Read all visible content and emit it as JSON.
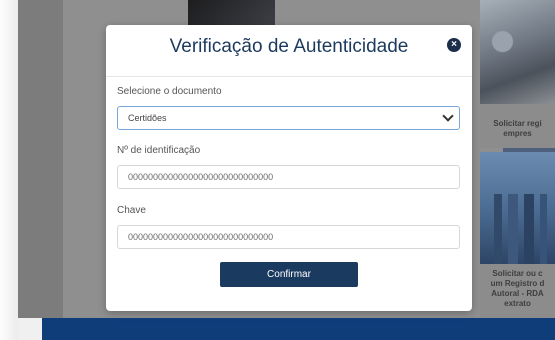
{
  "modal": {
    "title": "Verificação de Autenticidade",
    "close_symbol": "×",
    "document_label": "Selecione o documento",
    "document_selected": "Certidões",
    "id_label": "Nº de identificação",
    "id_value": "00000000000000000000000000000",
    "key_label": "Chave",
    "key_value": "00000000000000000000000000000",
    "confirm_label": "Confirmar"
  },
  "background_cards": [
    {
      "line1": "Solicitar regi",
      "line2": "empres"
    },
    {
      "line1": "Solicitar ou c",
      "line2": "um Registro d",
      "line3": "Autoral - RDA",
      "line4": "extrato"
    }
  ],
  "colors": {
    "accent": "#1b3a60",
    "title": "#1c3a5e",
    "footer": "#0e3d7a"
  }
}
